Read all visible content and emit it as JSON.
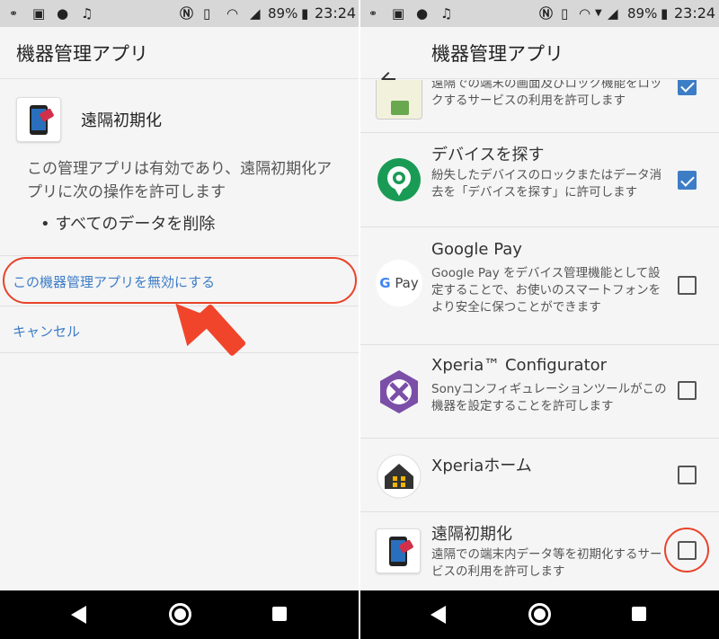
{
  "status": {
    "battery": "89%",
    "time": "23:24"
  },
  "left": {
    "title": "機器管理アプリ",
    "app_name": "遠隔初期化",
    "description": "この管理アプリは有効であり、遠隔初期化アプリに次の操作を許可します",
    "bullet": "• すべてのデータを削除",
    "deactivate_label": "この機器管理アプリを無効にする",
    "cancel_label": "キャンセル"
  },
  "right": {
    "title": "機器管理アプリ",
    "items": [
      {
        "title": "",
        "desc": "遠隔での端末の画面及びロック機能をロックするサービスの利用を許可します",
        "checked": true,
        "icon": "lock-icon"
      },
      {
        "title": "デバイスを探す",
        "desc": "紛失したデバイスのロックまたはデータ消去を「デバイスを探す」に許可します",
        "checked": true,
        "icon": "find-device-icon"
      },
      {
        "title": "Google Pay",
        "desc": "Google Pay をデバイス管理機能として設定することで、お使いのスマートフォンをより安全に保つことができます",
        "checked": false,
        "icon": "google-pay-icon",
        "icon_text": "G Pay"
      },
      {
        "title": "Xperia™ Configurator",
        "desc": "Sonyコンフィギュレーションツールがこの機器を設定することを許可します",
        "checked": false,
        "icon": "configurator-icon"
      },
      {
        "title": "Xperiaホーム",
        "desc": "",
        "checked": false,
        "icon": "xperia-home-icon"
      },
      {
        "title": "遠隔初期化",
        "desc": "遠隔での端末内データ等を初期化するサービスの利用を許可します",
        "checked": false,
        "icon": "remote-wipe-icon"
      }
    ]
  },
  "colors": {
    "accent": "#3d7dc6",
    "highlight": "#e8432a",
    "statusbar": "#d7d7d7"
  }
}
